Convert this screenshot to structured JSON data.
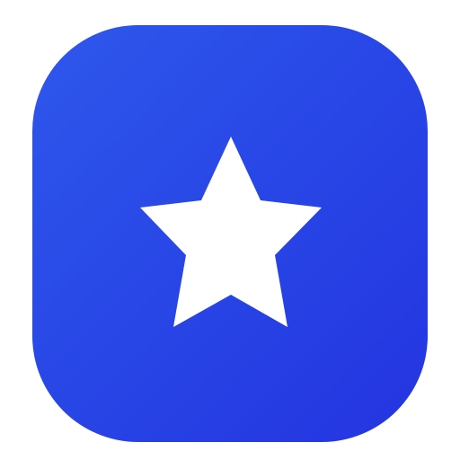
{
  "app_icon": {
    "symbol": "star-icon",
    "colors": {
      "background_start": "#2e57ec",
      "background_end": "#2434e0",
      "symbol": "#ffffff",
      "page_background": "#ffffff"
    }
  }
}
